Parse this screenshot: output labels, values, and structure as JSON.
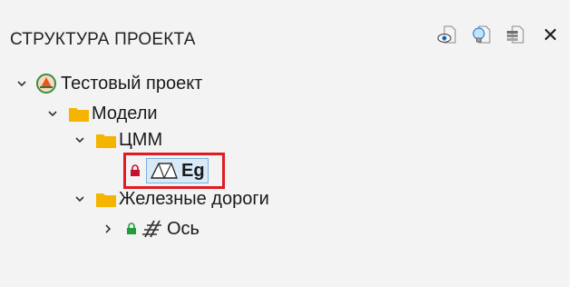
{
  "panel": {
    "title": "СТРУКТУРА ПРОЕКТА",
    "toolbar_icons": [
      "eye-page-icon",
      "lightbulb-page-icon",
      "layers-page-icon"
    ],
    "close_icon": "close-icon"
  },
  "tree": {
    "project": {
      "label": "Тестовый проект",
      "icon": "project-logo-icon"
    },
    "models": {
      "label": "Модели",
      "icon": "folder-icon"
    },
    "dtm": {
      "label": "ЦММ",
      "icon": "folder-icon"
    },
    "surface": {
      "label": "Eg",
      "icon": "surface-triangles-icon",
      "lock": "lock-red-icon",
      "selected": true
    },
    "railways": {
      "label": "Железные дороги",
      "icon": "folder-icon"
    },
    "axis": {
      "label": "Ось",
      "icon": "rail-track-icon",
      "lock": "lock-green-icon"
    }
  },
  "colors": {
    "folder": "#f5b400",
    "highlight": "#e11b22",
    "lock_red": "#c8102e",
    "lock_green": "#1f9d3a",
    "selection_bg": "#d8eaf8"
  }
}
